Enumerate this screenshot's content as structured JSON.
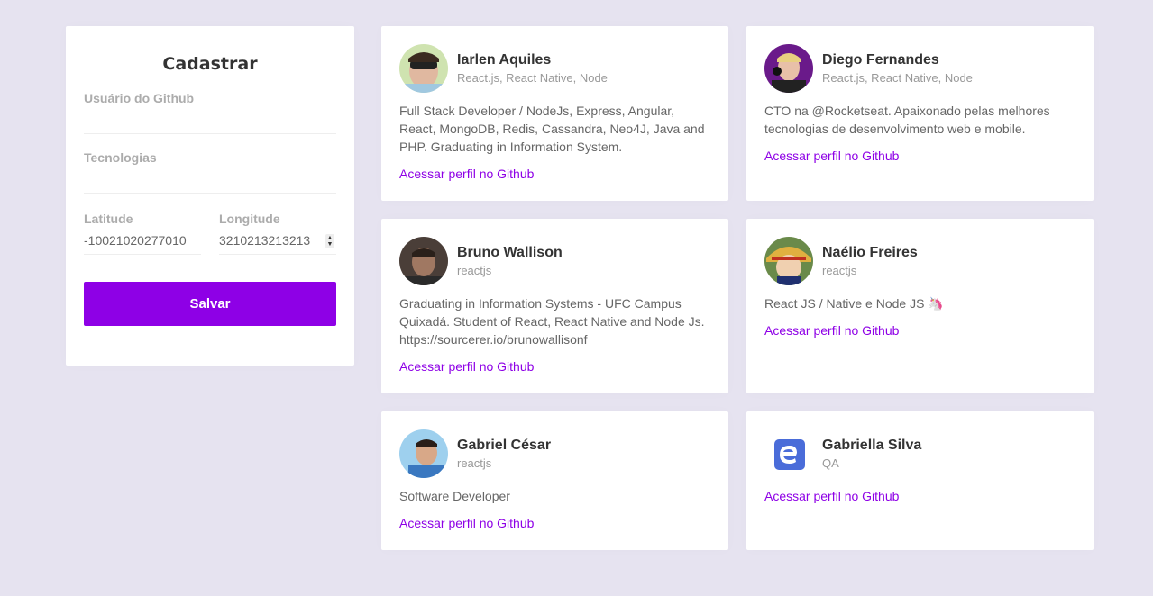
{
  "form": {
    "title": "Cadastrar",
    "github_user_label": "Usuário do Github",
    "github_user_value": "",
    "techs_label": "Tecnologias",
    "techs_value": "",
    "latitude_label": "Latitude",
    "latitude_value": "-10021020277010",
    "longitude_label": "Longitude",
    "longitude_value": "3210213213213",
    "save_label": "Salvar"
  },
  "colors": {
    "background": "#e6e3f0",
    "accent": "#8e00e6"
  },
  "devs": [
    {
      "name": "Iarlen Aquiles",
      "techs": "React.js, React Native, Node",
      "bio": "Full Stack Developer / NodeJs, Express, Angular, React, MongoDB, Redis, Cassandra, Neo4J, Java and PHP. Graduating in Information System.",
      "link_label": "Acessar perfil no Github",
      "avatar_color": "#c9d9a8"
    },
    {
      "name": "Diego Fernandes",
      "techs": "React.js, React Native, Node",
      "bio": "CTO na @Rocketseat. Apaixonado pelas melhores tecnologias de desenvolvimento web e mobile.",
      "link_label": "Acessar perfil no Github",
      "avatar_color": "#6a1a8a"
    },
    {
      "name": "Bruno Wallison",
      "techs": "reactjs",
      "bio": "Graduating in Information Systems - UFC Campus Quixadá.  Student of React, React Native and Node Js. https://sourcerer.io/brunowallisonf",
      "link_label": "Acessar perfil no Github",
      "avatar_color": "#5a4a42"
    },
    {
      "name": "Naélio Freires",
      "techs": "reactjs",
      "bio": "React JS / Native e Node JS 🦄",
      "link_label": "Acessar perfil no Github",
      "avatar_color": "#d9a63a"
    },
    {
      "name": "Gabriel César",
      "techs": "reactjs",
      "bio": "Software Developer",
      "link_label": "Acessar perfil no Github",
      "avatar_color": "#8ec6e6"
    },
    {
      "name": "Gabriella Silva",
      "techs": "QA",
      "bio": "",
      "link_label": "Acessar perfil no Github",
      "avatar_color": "#4a6cd9"
    }
  ]
}
